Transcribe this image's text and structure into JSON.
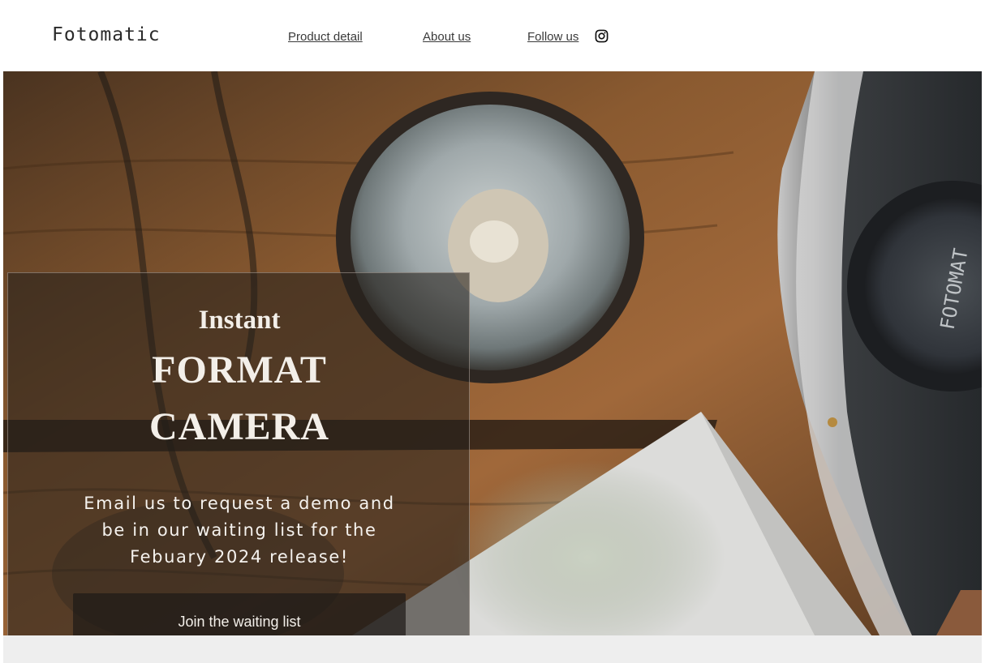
{
  "header": {
    "logo": "Fotomatic",
    "nav": {
      "product_detail": "Product detail",
      "about_us": "About us",
      "follow_us": "Follow us "
    },
    "social_icon": "instagram-icon"
  },
  "hero": {
    "background_image": "camera-and-bowl-on-wooden-table-photo",
    "headline_line1": "Instant",
    "headline_line2": "FORMAT",
    "headline_line3": "CAMERA",
    "description": "Email us to request a demo and be in our waiting list for the Febuary 2024 release!",
    "cta_label": "Join the waiting list"
  },
  "colors": {
    "panel_overlay": "#26201c",
    "headline_text": "#f3efe9",
    "nav_text": "#3a3a3a",
    "footer_strip": "#eeeeee"
  }
}
